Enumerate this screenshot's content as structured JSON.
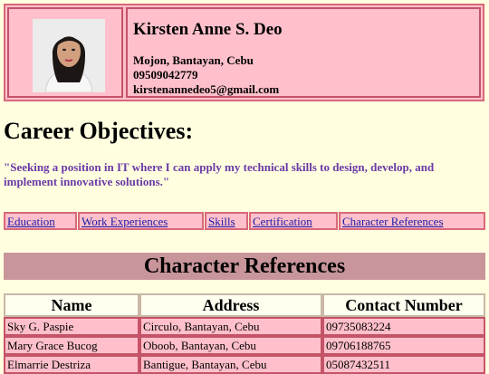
{
  "profile": {
    "name": "Kirsten Anne S. Deo",
    "address": "Mojon, Bantayan, Cebu",
    "phone": "09509042779",
    "email": "kirstenannedeo5@gmail.com"
  },
  "objectives": {
    "title": "Career Objectives:",
    "text": "\"Seeking a position in IT where I can apply my technical skills to design, develop, and implement innovative solutions.\""
  },
  "nav": {
    "education": "Education",
    "work": "Work Experiences",
    "skills": "Skills",
    "certification": "Certification",
    "references": "Character References"
  },
  "references": {
    "title": "Character References",
    "headers": [
      "Name",
      "Address",
      "Contact Number"
    ],
    "rows": [
      [
        "Sky G. Paspie",
        "Circulo, Bantayan, Cebu",
        "09735083224"
      ],
      [
        "Mary Grace Bucog",
        "Oboob, Bantayan, Cebu",
        "09706188765"
      ],
      [
        "Elmarrie Destriza",
        "Bantigue, Bantayan, Cebu",
        "05087432511"
      ]
    ]
  }
}
